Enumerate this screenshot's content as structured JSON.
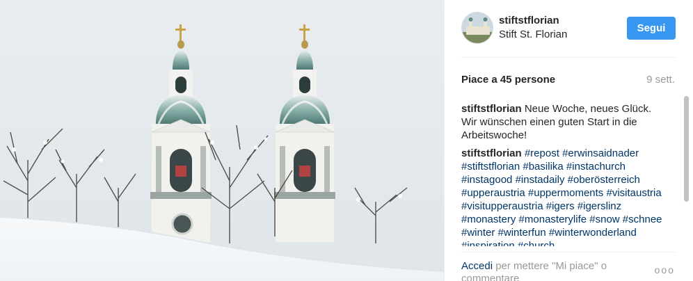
{
  "post": {
    "image_alt": "Stift St. Florian towers in snow"
  },
  "header": {
    "username": "stiftstflorian",
    "location": "Stift St. Florian",
    "follow_label": "Segui"
  },
  "likes": {
    "text": "Piace a 45 persone",
    "age": "9 sett."
  },
  "caption": {
    "author": "stiftstflorian",
    "text": "Neue Woche, neues Glück. Wir wünschen einen guten Start in die Arbeitswoche!"
  },
  "hashtag_comment": {
    "author": "stiftstflorian",
    "tags": [
      "#repost",
      "#erwinsaidnader",
      "#stiftstflorian",
      "#basilika",
      "#instachurch",
      "#instagood",
      "#instadaily",
      "#oberösterreich",
      "#upperaustria",
      "#uppermoments",
      "#visitaustria",
      "#visitupperaustria",
      "#igers",
      "#igerslinz",
      "#monastery",
      "#monasterylife",
      "#snow",
      "#schnee",
      "#winter",
      "#winterfun",
      "#winterwonderland",
      "#inspiration",
      "#church"
    ]
  },
  "footer": {
    "login_link": "Accedi",
    "login_text": " per mettere \"Mi piace\" o commentare",
    "more_label": "ooo"
  },
  "colors": {
    "follow_button": "#3897f0",
    "hashtag_link": "#003569",
    "muted_text": "#999999"
  },
  "icons": {
    "more": "ellipsis-icon"
  }
}
